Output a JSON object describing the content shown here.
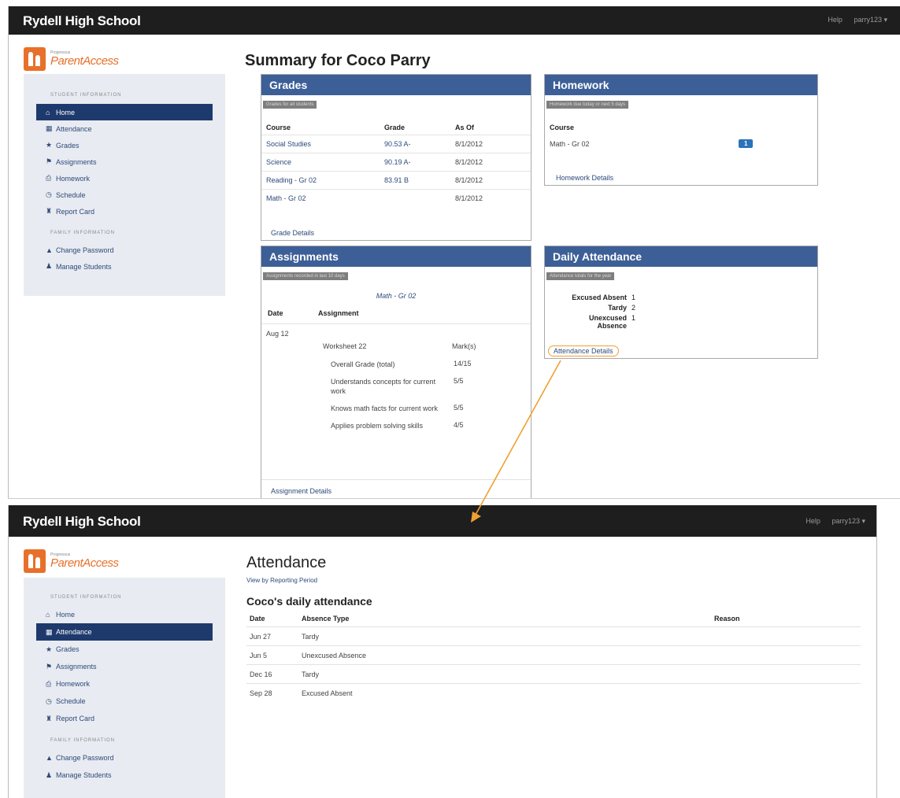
{
  "screen1": {
    "header": {
      "brand": "Rydell High School",
      "help": "Help",
      "user": "parry123 ▾"
    },
    "logo": {
      "small": "Progressus",
      "big": "ParentAccess"
    },
    "sidebar": {
      "student_heading": "STUDENT INFORMATION",
      "items": [
        {
          "label": "Home",
          "icon": "home-icon",
          "glyph": "⌂",
          "active": true
        },
        {
          "label": "Attendance",
          "icon": "calendar-icon",
          "glyph": "▦",
          "active": false
        },
        {
          "label": "Grades",
          "icon": "star-icon",
          "glyph": "★",
          "active": false
        },
        {
          "label": "Assignments",
          "icon": "flag-icon",
          "glyph": "⚑",
          "active": false
        },
        {
          "label": "Homework",
          "icon": "printer-icon",
          "glyph": "⎙",
          "active": false
        },
        {
          "label": "Schedule",
          "icon": "clock-icon",
          "glyph": "◷",
          "active": false
        },
        {
          "label": "Report Card",
          "icon": "school-icon",
          "glyph": "♜",
          "active": false
        }
      ],
      "family_heading": "FAMILY INFORMATION",
      "family_items": [
        {
          "label": "Change Password",
          "icon": "lock-icon",
          "glyph": "▲"
        },
        {
          "label": "Manage Students",
          "icon": "user-icon",
          "glyph": "♟"
        }
      ]
    },
    "summary_title": "Summary for Coco Parry",
    "grades": {
      "title": "Grades",
      "subtitle": "Grades for all students",
      "headers": [
        "Course",
        "Grade",
        "As Of"
      ],
      "rows": [
        {
          "course": "Social Studies",
          "grade": "90.53 A-",
          "as_of": "8/1/2012"
        },
        {
          "course": "Science",
          "grade": "90.19 A-",
          "as_of": "8/1/2012"
        },
        {
          "course": "Reading - Gr 02",
          "grade": "83.91 B",
          "as_of": "8/1/2012"
        },
        {
          "course": "Math - Gr 02",
          "grade": "",
          "as_of": "8/1/2012"
        }
      ],
      "link": "Grade Details"
    },
    "homework": {
      "title": "Homework",
      "subtitle": "Homework due today or next 5 days",
      "header": "Course",
      "rows": [
        {
          "course": "Math - Gr 02",
          "count": "1"
        }
      ],
      "link": "Homework Details"
    },
    "assignments": {
      "title": "Assignments",
      "subtitle": "Assignments recorded in last 10 days",
      "course": "Math - Gr 02",
      "headers": [
        "Date",
        "Assignment"
      ],
      "date": "Aug 12",
      "name": "Worksheet 22",
      "mark_header": "Mark(s)",
      "marks": [
        {
          "label": "Overall Grade (total)",
          "value": "14/15"
        },
        {
          "label": "Understands concepts for current work",
          "value": "5/5"
        },
        {
          "label": "Knows math facts for current work",
          "value": "5/5"
        },
        {
          "label": "Applies problem solving skills",
          "value": "4/5"
        }
      ],
      "link": "Assignment Details"
    },
    "daily_attendance": {
      "title": "Daily Attendance",
      "subtitle": "Attendance totals for the year",
      "stats": [
        {
          "label": "Excused Absent",
          "value": "1"
        },
        {
          "label": "Tardy",
          "value": "2"
        },
        {
          "label": "Unexcused Absence",
          "value": "1"
        }
      ],
      "link": "Attendance Details"
    }
  },
  "screen2": {
    "header": {
      "brand": "Rydell High School",
      "help": "Help",
      "user": "parry123 ▾"
    },
    "logo": {
      "small": "Progressus",
      "big": "ParentAccess"
    },
    "sidebar": {
      "student_heading": "STUDENT INFORMATION",
      "items": [
        {
          "label": "Home",
          "icon": "home-icon",
          "glyph": "⌂",
          "active": false
        },
        {
          "label": "Attendance",
          "icon": "calendar-icon",
          "glyph": "▦",
          "active": true
        },
        {
          "label": "Grades",
          "icon": "star-icon",
          "glyph": "★",
          "active": false
        },
        {
          "label": "Assignments",
          "icon": "flag-icon",
          "glyph": "⚑",
          "active": false
        },
        {
          "label": "Homework",
          "icon": "printer-icon",
          "glyph": "⎙",
          "active": false
        },
        {
          "label": "Schedule",
          "icon": "clock-icon",
          "glyph": "◷",
          "active": false
        },
        {
          "label": "Report Card",
          "icon": "school-icon",
          "glyph": "♜",
          "active": false
        }
      ],
      "family_heading": "FAMILY INFORMATION",
      "family_items": [
        {
          "label": "Change Password",
          "icon": "lock-icon",
          "glyph": "▲"
        },
        {
          "label": "Manage Students",
          "icon": "user-icon",
          "glyph": "♟"
        }
      ]
    },
    "attendance_title": "Attendance",
    "view_link": "View by Reporting Period",
    "daily_heading": "Coco's daily attendance",
    "headers": [
      "Date",
      "Absence Type",
      "Reason"
    ],
    "rows": [
      {
        "date": "Jun 27",
        "type": "Tardy",
        "reason": ""
      },
      {
        "date": "Jun 5",
        "type": "Unexcused Absence",
        "reason": ""
      },
      {
        "date": "Dec 16",
        "type": "Tardy",
        "reason": ""
      },
      {
        "date": "Sep 28",
        "type": "Excused Absent",
        "reason": ""
      }
    ]
  },
  "colors": {
    "navbar": "#1e1e1e",
    "panel_header": "#3d5f97",
    "active_nav": "#1e3a6d",
    "logo": "#e8702a",
    "annotation": "#f0a030"
  }
}
